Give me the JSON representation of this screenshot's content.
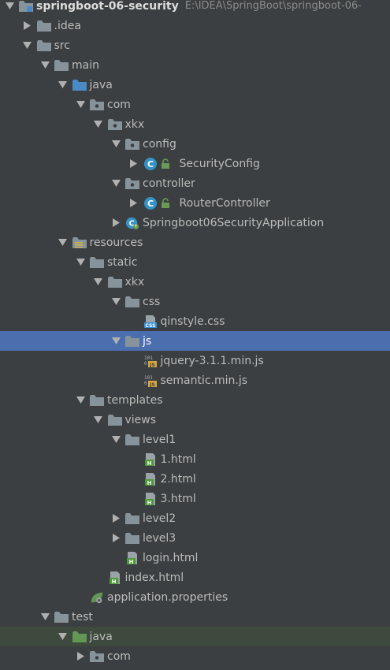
{
  "project": {
    "name": "springboot-06-security",
    "path": "E:\\IDEA\\SpringBoot\\springboot-06-"
  },
  "nodes": [
    {
      "label": "springboot-06-security",
      "depth": 0,
      "arrow": "down",
      "icon": "module-folder-icon",
      "path": "E:\\IDEA\\SpringBoot\\springboot-06-"
    },
    {
      "label": ".idea",
      "depth": 1,
      "arrow": "right",
      "icon": "folder-icon"
    },
    {
      "label": "src",
      "depth": 1,
      "arrow": "down",
      "icon": "folder-icon"
    },
    {
      "label": "main",
      "depth": 2,
      "arrow": "down",
      "icon": "folder-icon"
    },
    {
      "label": "java",
      "depth": 3,
      "arrow": "down",
      "icon": "source-folder-icon"
    },
    {
      "label": "com",
      "depth": 4,
      "arrow": "down",
      "icon": "package-icon"
    },
    {
      "label": "xkx",
      "depth": 5,
      "arrow": "down",
      "icon": "package-icon"
    },
    {
      "label": "config",
      "depth": 6,
      "arrow": "down",
      "icon": "package-icon"
    },
    {
      "label": "SecurityConfig",
      "depth": 7,
      "arrow": "right",
      "icon": "class-icon"
    },
    {
      "label": "controller",
      "depth": 6,
      "arrow": "down",
      "icon": "package-icon"
    },
    {
      "label": "RouterController",
      "depth": 7,
      "arrow": "right",
      "icon": "class-icon"
    },
    {
      "label": "Springboot06SecurityApplication",
      "depth": 6,
      "arrow": "right",
      "icon": "spring-boot-class-icon"
    },
    {
      "label": "resources",
      "depth": 3,
      "arrow": "down",
      "icon": "resources-folder-icon"
    },
    {
      "label": "static",
      "depth": 4,
      "arrow": "down",
      "icon": "folder-icon"
    },
    {
      "label": "xkx",
      "depth": 5,
      "arrow": "down",
      "icon": "folder-icon"
    },
    {
      "label": "css",
      "depth": 6,
      "arrow": "down",
      "icon": "folder-icon"
    },
    {
      "label": "qinstyle.css",
      "depth": 7,
      "arrow": "none",
      "icon": "css-file-icon"
    },
    {
      "label": "js",
      "depth": 6,
      "arrow": "down",
      "icon": "folder-icon",
      "selected": true
    },
    {
      "label": "jquery-3.1.1.min.js",
      "depth": 7,
      "arrow": "none",
      "icon": "js-file-icon"
    },
    {
      "label": "semantic.min.js",
      "depth": 7,
      "arrow": "none",
      "icon": "js-file-icon"
    },
    {
      "label": "templates",
      "depth": 4,
      "arrow": "down",
      "icon": "folder-icon"
    },
    {
      "label": "views",
      "depth": 5,
      "arrow": "down",
      "icon": "folder-icon"
    },
    {
      "label": "level1",
      "depth": 6,
      "arrow": "down",
      "icon": "folder-icon"
    },
    {
      "label": "1.html",
      "depth": 7,
      "arrow": "none",
      "icon": "html-file-icon"
    },
    {
      "label": "2.html",
      "depth": 7,
      "arrow": "none",
      "icon": "html-file-icon"
    },
    {
      "label": "3.html",
      "depth": 7,
      "arrow": "none",
      "icon": "html-file-icon"
    },
    {
      "label": "level2",
      "depth": 6,
      "arrow": "right",
      "icon": "folder-icon"
    },
    {
      "label": "level3",
      "depth": 6,
      "arrow": "right",
      "icon": "folder-icon"
    },
    {
      "label": "login.html",
      "depth": 6,
      "arrow": "none",
      "icon": "html-file-icon"
    },
    {
      "label": "index.html",
      "depth": 5,
      "arrow": "none",
      "icon": "html-file-icon"
    },
    {
      "label": "application.properties",
      "depth": 4,
      "arrow": "none",
      "icon": "spring-properties-icon"
    },
    {
      "label": "test",
      "depth": 2,
      "arrow": "down",
      "icon": "folder-icon"
    },
    {
      "label": "java",
      "depth": 3,
      "arrow": "down",
      "icon": "test-source-folder-icon",
      "test": true
    },
    {
      "label": "com",
      "depth": 4,
      "arrow": "right",
      "icon": "package-icon"
    }
  ],
  "colors": {
    "background": "#3c3f41",
    "selection": "#4b6eaf",
    "folder": "#87939a",
    "source_folder": "#4a8ac6",
    "test_folder": "#629755",
    "class_circle": "#3592c4",
    "lock": "#6a9955",
    "js_badge": "#d6a642",
    "css_badge": "#3a8fd5",
    "html_badge": "#4e9a3a"
  }
}
